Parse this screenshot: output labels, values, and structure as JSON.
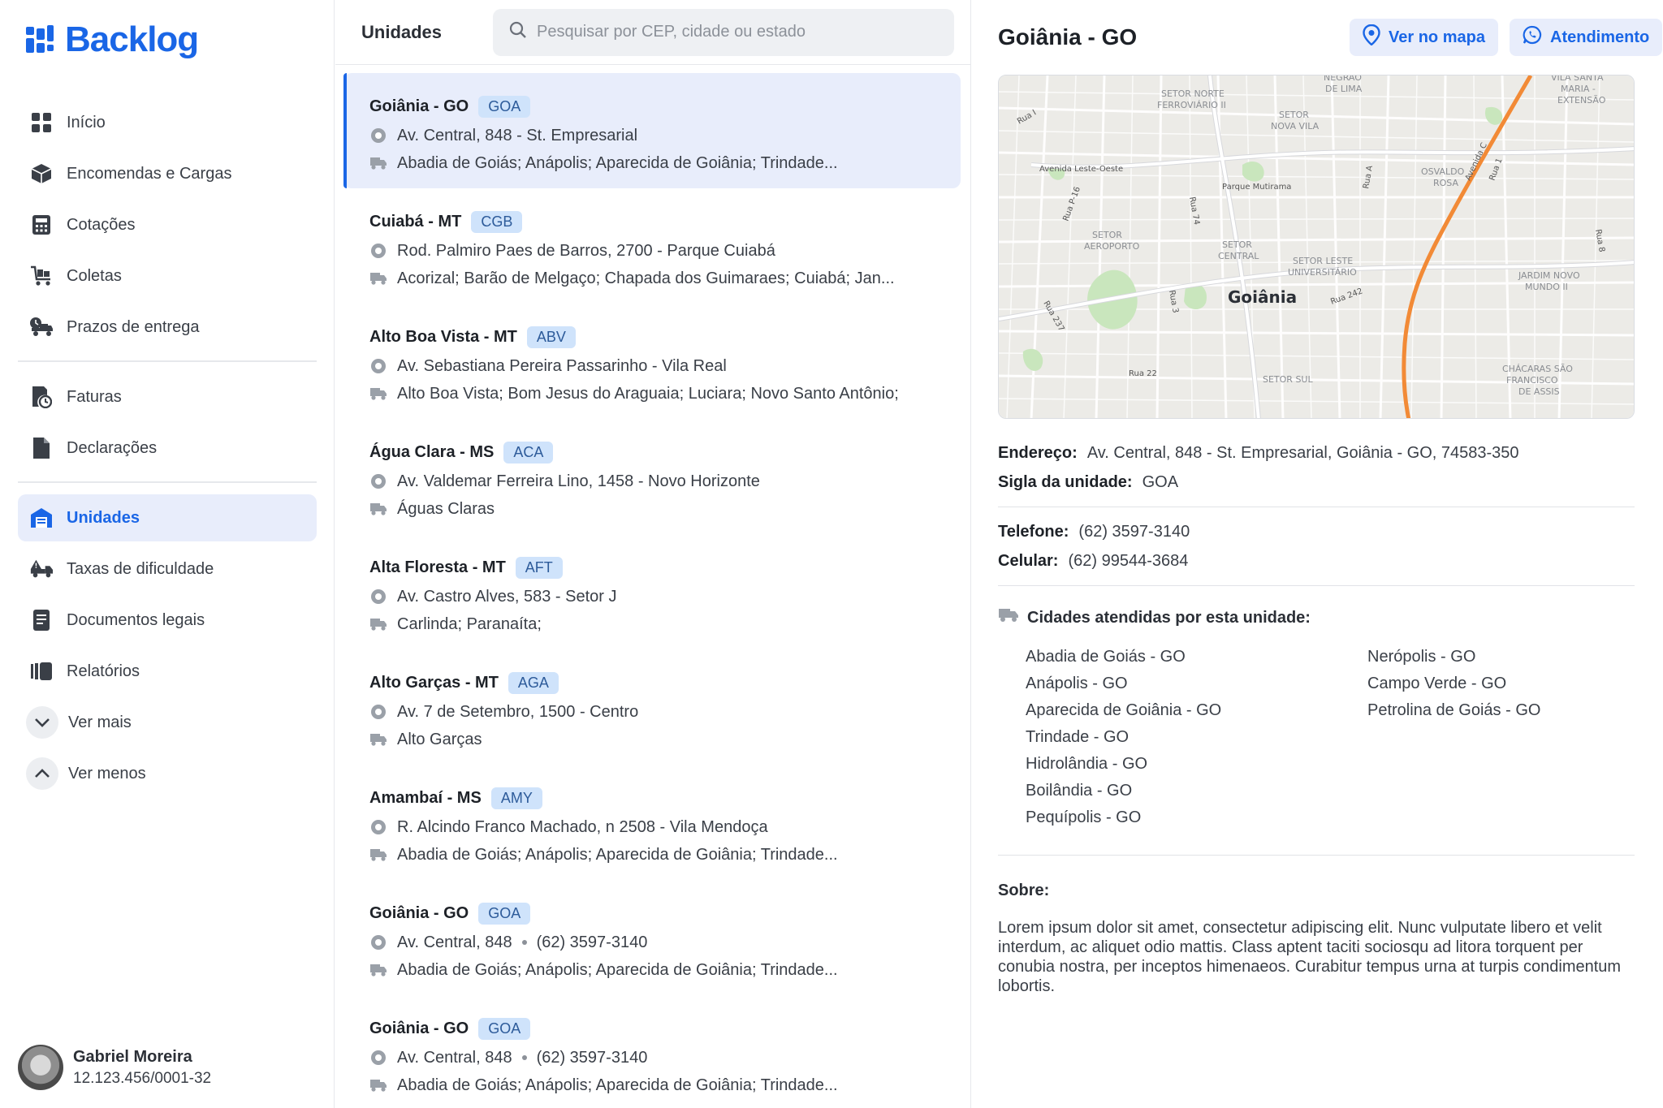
{
  "app": {
    "name": "Backlog"
  },
  "sidebar": {
    "items": [
      {
        "label": "Início",
        "icon": "grid-icon",
        "active": false
      },
      {
        "label": "Encomendas e Cargas",
        "icon": "package-icon",
        "active": false
      },
      {
        "label": "Cotações",
        "icon": "calculator-icon",
        "active": false
      },
      {
        "label": "Coletas",
        "icon": "cart-icon",
        "active": false
      },
      {
        "label": "Prazos de entrega",
        "icon": "delivery-truck-icon",
        "active": false
      },
      {
        "label": "Faturas",
        "icon": "invoice-clock-icon",
        "active": false
      },
      {
        "label": "Declarações",
        "icon": "document-icon",
        "active": false
      },
      {
        "label": "Unidades",
        "icon": "warehouse-icon",
        "active": true
      },
      {
        "label": "Taxas de dificuldade",
        "icon": "truck-warning-icon",
        "active": false
      },
      {
        "label": "Documentos legais",
        "icon": "legal-document-icon",
        "active": false
      },
      {
        "label": "Relatórios",
        "icon": "reports-icon",
        "active": false
      }
    ],
    "more_label": "Ver mais",
    "less_label": "Ver menos",
    "user": {
      "name": "Gabriel Moreira",
      "doc": "12.123.456/0001-32"
    }
  },
  "list": {
    "title": "Unidades",
    "search_placeholder": "Pesquisar por CEP, cidade ou estado",
    "rows": [
      {
        "name": "Goiânia - GO",
        "code": "GOA",
        "address": "Av. Central, 848 - St. Empresarial",
        "phone": "",
        "cities": "Abadia de Goiás; Anápolis; Aparecida de Goiânia; Trindade...",
        "selected": true
      },
      {
        "name": "Cuiabá - MT",
        "code": "CGB",
        "address": "Rod. Palmiro Paes de Barros, 2700 - Parque Cuiabá",
        "phone": "",
        "cities": "Acorizal; Barão de Melgaço; Chapada dos Guimaraes; Cuiabá; Jan...",
        "selected": false
      },
      {
        "name": "Alto Boa Vista - MT",
        "code": "ABV",
        "address": "Av. Sebastiana Pereira Passarinho - Vila Real",
        "phone": "",
        "cities": "Alto Boa Vista; Bom Jesus do Araguaia; Luciara; Novo Santo Antônio;",
        "selected": false
      },
      {
        "name": "Água Clara - MS",
        "code": "ACA",
        "address": "Av. Valdemar Ferreira Lino, 1458 - Novo Horizonte",
        "phone": "",
        "cities": "Águas Claras",
        "selected": false
      },
      {
        "name": "Alta Floresta - MT",
        "code": "AFT",
        "address": "Av. Castro Alves, 583 - Setor J",
        "phone": "",
        "cities": "Carlinda; Paranaíta;",
        "selected": false
      },
      {
        "name": "Alto Garças - MT",
        "code": "AGA",
        "address": "Av. 7 de Setembro, 1500 - Centro",
        "phone": "",
        "cities": "Alto Garças",
        "selected": false
      },
      {
        "name": "Amambaí - MS",
        "code": "AMY",
        "address": "R. Alcindo Franco Machado, n 2508 - Vila Mendoça",
        "phone": "",
        "cities": "Abadia de Goiás; Anápolis; Aparecida de Goiânia; Trindade...",
        "selected": false
      },
      {
        "name": "Goiânia - GO",
        "code": "GOA",
        "address": "Av. Central, 848",
        "phone": "(62) 3597-3140",
        "cities": "Abadia de Goiás; Anápolis; Aparecida de Goiânia; Trindade...",
        "selected": false
      },
      {
        "name": "Goiânia - GO",
        "code": "GOA",
        "address": "Av. Central, 848",
        "phone": "(62) 3597-3140",
        "cities": "Abadia de Goiás; Anápolis; Aparecida de Goiânia; Trindade...",
        "selected": false
      }
    ]
  },
  "detail": {
    "title": "Goiânia - GO",
    "map_button": "Ver no mapa",
    "support_button": "Atendimento",
    "map_labels": {
      "city": "Goiânia",
      "districts": [
        "SETOR NORTE FERROVIÁRIO II",
        "SETOR NOVA VILA",
        "SETOR AEROPORTO",
        "SETOR CENTRAL",
        "SETOR LESTE UNIVERSITÁRIO",
        "SETOR SUL",
        "OSVALDO ROSA",
        "JARDIM NOVO MUNDO II",
        "CHÁCARAS SÃO FRANCISCO DE ASSIS",
        "VILA SANTA MARIA - EXTENSÃO",
        "NEGRÃO DE LIMA"
      ],
      "streets": [
        "Avenida Leste-Oeste",
        "Parque Mutirama",
        "Rua 74",
        "Rua 3",
        "Rua 242",
        "Rua 22",
        "Rua 237",
        "Rua A",
        "Rua 1",
        "Avenida C",
        "Rua 8",
        "Rua I",
        "Rua P-16"
      ]
    },
    "address_label": "Endereço:",
    "address": "Av. Central, 848 - St. Empresarial, Goiânia - GO, 74583-350",
    "code_label": "Sigla da unidade:",
    "code": "GOA",
    "phone_label": "Telefone:",
    "phone": "(62) 3597-3140",
    "mobile_label": "Celular:",
    "mobile": "(62) 99544-3684",
    "cities_title": "Cidades atendidas por esta unidade:",
    "cities_col1": [
      "Abadia de Goiás - GO",
      "Anápolis - GO",
      "Aparecida de Goiânia - GO",
      "Trindade - GO",
      "Hidrolândia - GO",
      "Boilândia - GO",
      "Pequípolis - GO"
    ],
    "cities_col2": [
      "Nerópolis - GO",
      "Campo Verde - GO",
      "Petrolina de Goiás - GO"
    ],
    "about_title": "Sobre:",
    "about": "Lorem ipsum dolor sit amet, consectetur adipiscing elit. Nunc vulputate libero et velit interdum, ac aliquet odio mattis. Class aptent taciti sociosqu ad litora torquent per conubia nostra, per inceptos himenaeos. Curabitur tempus urna at turpis condimentum lobortis."
  },
  "colors": {
    "accent": "#1a66e6",
    "active_bg": "#e8edfb",
    "tag_bg": "#cfe3fb",
    "map_route": "#f28a36"
  }
}
